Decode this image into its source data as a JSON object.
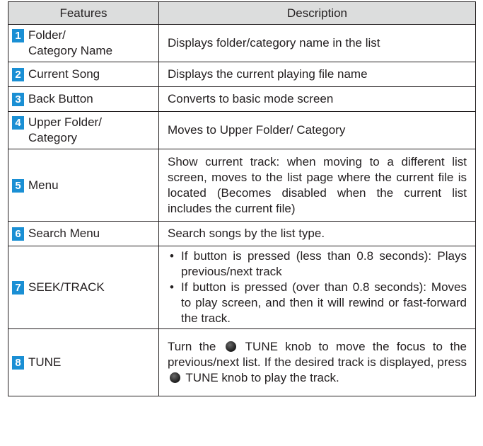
{
  "table": {
    "headers": [
      "Features",
      "Description"
    ],
    "rows": [
      {
        "num": "1",
        "feature": "Folder/\nCategory Name",
        "description": "Displays folder/category name in the list"
      },
      {
        "num": "2",
        "feature": "Current Song",
        "description": "Displays the current playing file name"
      },
      {
        "num": "3",
        "feature": "Back Button",
        "description": "Converts to basic mode screen"
      },
      {
        "num": "4",
        "feature": "Upper Folder/\nCategory",
        "description": "Moves to Upper Folder/ Category"
      },
      {
        "num": "5",
        "feature": "Menu",
        "description": "Show current track: when moving to a different list screen, moves to the list page where the current file is located (Becomes disabled when the current list includes the current file)"
      },
      {
        "num": "6",
        "feature": "Search Menu",
        "description": "Search songs by the list type."
      },
      {
        "num": "7",
        "feature": "SEEK/TRACK",
        "bullets": [
          "If button is pressed (less than 0.8 seconds): Plays previous/next track",
          "If button is pressed (over than 0.8 seconds): Moves to play screen, and then it will rewind or fast-forward the track."
        ]
      },
      {
        "num": "8",
        "feature": "TUNE",
        "desc_part1": "Turn the",
        "desc_part2": "TUNE knob to move the focus to the previous/next list. If the desired track is displayed, press",
        "desc_part3": "TUNE knob to play the track."
      }
    ]
  },
  "colors": {
    "header_bg": "#dcdddd",
    "number_badge": "#1a8fd4",
    "border": "#231f20"
  },
  "icons": {
    "knob": "tune-knob-icon"
  }
}
